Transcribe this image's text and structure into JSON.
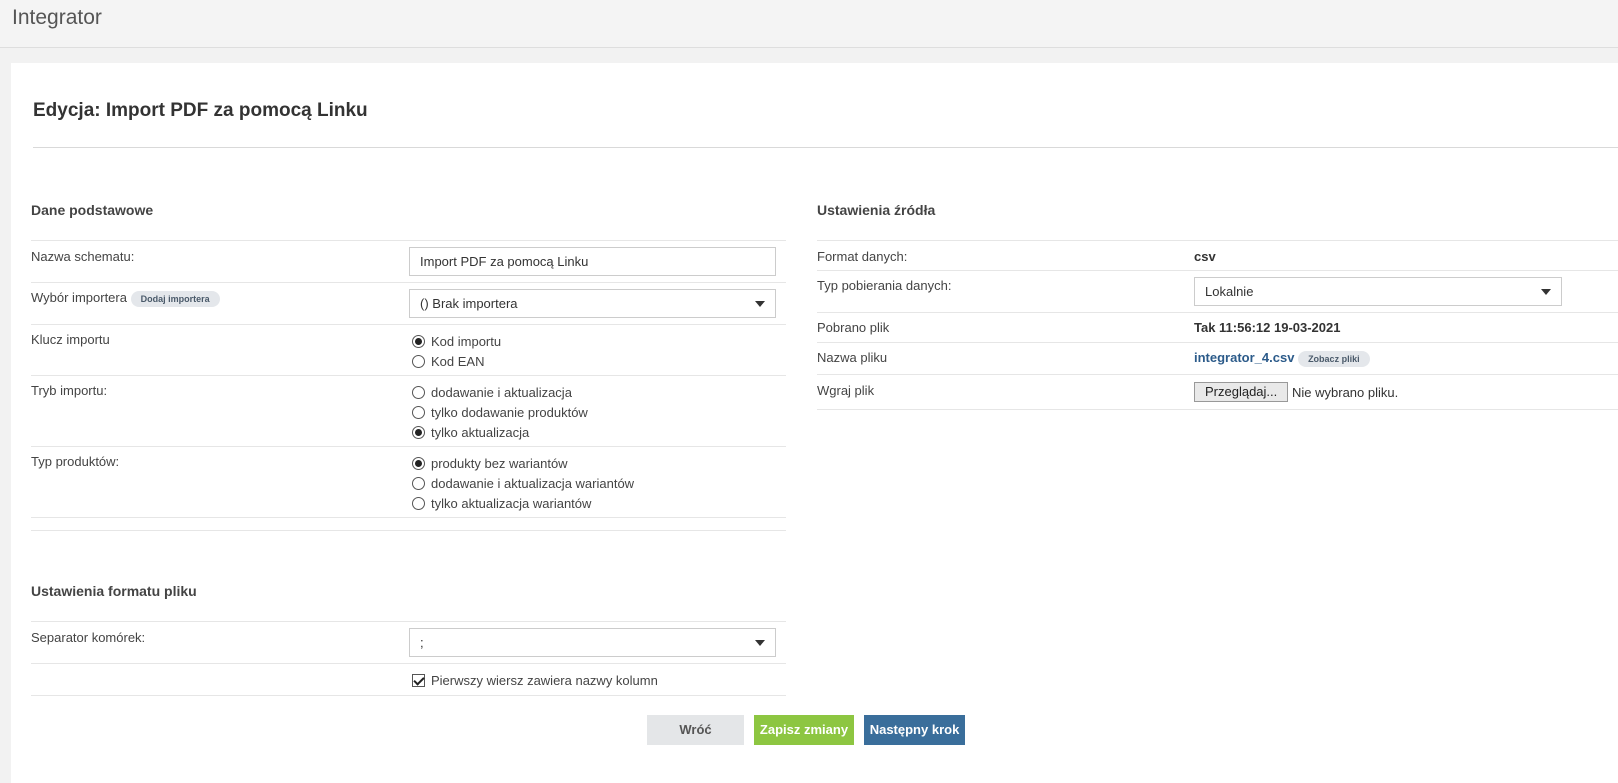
{
  "app": {
    "title": "Integrator"
  },
  "page": {
    "title": "Edycja: Import PDF za pomocą Linku"
  },
  "basic": {
    "section_title": "Dane podstawowe",
    "schema_name_label": "Nazwa schematu:",
    "schema_name_value": "Import PDF za pomocą Linku",
    "importer_label": "Wybór importera",
    "add_importer_label": "Dodaj importera",
    "importer_value": "() Brak importera",
    "import_key_label": "Klucz importu",
    "import_key_options": [
      {
        "label": "Kod importu",
        "checked": true
      },
      {
        "label": "Kod EAN",
        "checked": false
      }
    ],
    "import_mode_label": "Tryb importu:",
    "import_mode_options": [
      {
        "label": "dodawanie i aktualizacja",
        "checked": false
      },
      {
        "label": "tylko dodawanie produktów",
        "checked": false
      },
      {
        "label": "tylko aktualizacja",
        "checked": true
      }
    ],
    "product_type_label": "Typ produktów:",
    "product_type_options": [
      {
        "label": "produkty bez wariantów",
        "checked": true
      },
      {
        "label": "dodawanie i aktualizacja wariantów",
        "checked": false
      },
      {
        "label": "tylko aktualizacja wariantów",
        "checked": false
      }
    ]
  },
  "file_format": {
    "section_title": "Ustawienia formatu pliku",
    "separator_label": "Separator komórek:",
    "separator_value": ";",
    "header_row_label": "Pierwszy wiersz zawiera nazwy kolumn",
    "header_row_checked": true
  },
  "source": {
    "section_title": "Ustawienia źródła",
    "data_format_label": "Format danych:",
    "data_format_value": "csv",
    "download_type_label": "Typ pobierania danych:",
    "download_type_value": "Lokalnie",
    "downloaded_label": "Pobrano plik",
    "downloaded_value": "Tak 11:56:12 19-03-2021",
    "file_name_label": "Nazwa pliku",
    "file_name_value": "integrator_4.csv",
    "view_files_label": "Zobacz pliki",
    "upload_label": "Wgraj plik",
    "browse_label": "Przeglądaj...",
    "no_file_label": "Nie wybrano pliku."
  },
  "actions": {
    "back_label": "Wróć",
    "save_label": "Zapisz zmiany",
    "next_label": "Następny krok"
  },
  "colors": {
    "save_button": "#8dc641",
    "next_button": "#3a6e9b",
    "back_button": "#e4e6e8",
    "link": "#2c5b8a"
  }
}
